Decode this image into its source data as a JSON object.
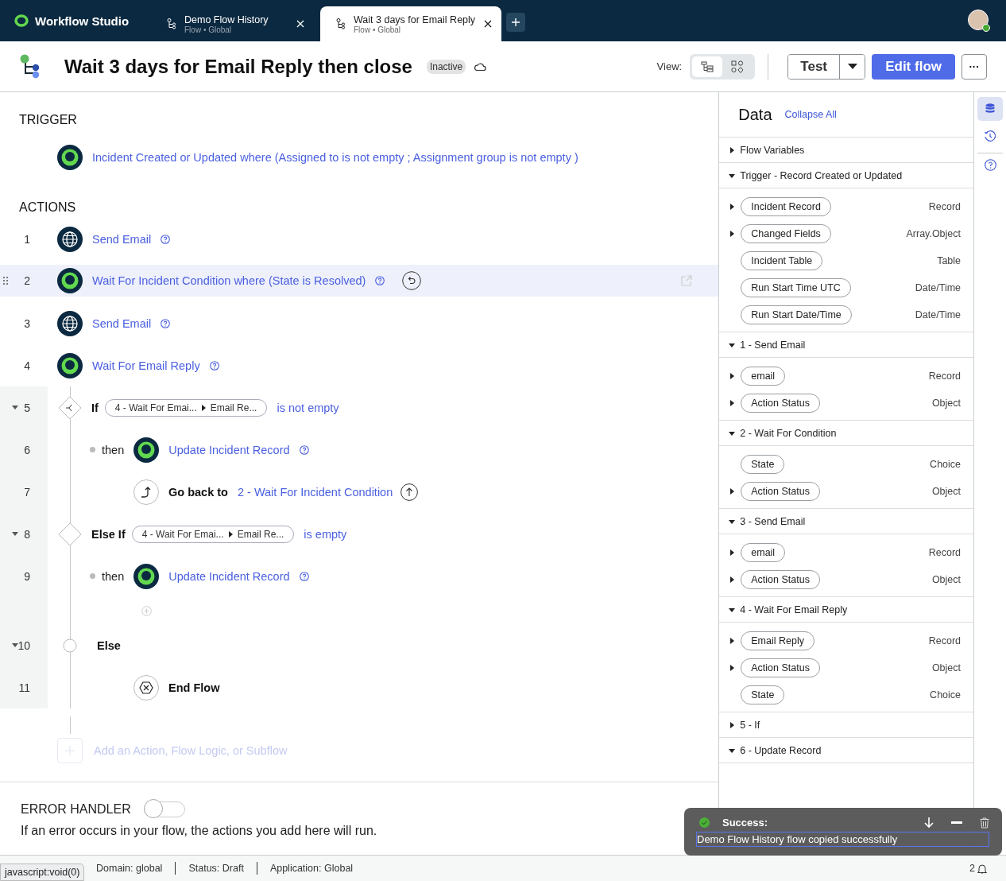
{
  "topbar": {
    "app_name": "Workflow Studio",
    "tabs": [
      {
        "title": "Demo Flow History",
        "subtitle": "Flow • Global",
        "selected": false
      },
      {
        "title": "Wait 3 days for Email Reply",
        "subtitle": "Flow • Global",
        "selected": true
      }
    ]
  },
  "header": {
    "title": "Wait 3 days for Email Reply then close",
    "badge": "Inactive",
    "view_label": "View:",
    "views": [
      {
        "kind": "tree",
        "selected": true
      },
      {
        "kind": "diagram",
        "selected": false
      }
    ],
    "test_button": "Test",
    "edit_button": "Edit flow",
    "more_button": "···"
  },
  "trigger": {
    "heading": "TRIGGER",
    "label": "Incident Created or Updated where (Assigned to is not empty ; Assignment group is not empty )"
  },
  "actions_heading": "ACTIONS",
  "actions": [
    {
      "number": "1",
      "kind": "email",
      "label": "Send Email",
      "selected": false
    },
    {
      "number": "2",
      "kind": "record",
      "label": "Wait For Incident Condition where (State is Resolved)",
      "selected": true
    },
    {
      "number": "3",
      "kind": "email",
      "label": "Send Email",
      "selected": false
    },
    {
      "number": "4",
      "kind": "record",
      "label": "Wait For Email Reply",
      "selected": false
    },
    {
      "number": "5",
      "kind": "if",
      "keyword": "If",
      "pill": [
        "4 - Wait For Emai...",
        "Email Re..."
      ],
      "condition": "is not empty",
      "expanded": true,
      "children": [
        {
          "number": "6",
          "kind": "record",
          "lead": "then",
          "label": "Update Incident Record",
          "selected": false
        },
        {
          "number": "7",
          "kind": "goback",
          "keyword": "Go back to",
          "target": "2 - Wait For Incident Condition"
        }
      ]
    },
    {
      "number": "8",
      "kind": "elseif",
      "keyword": "Else If",
      "pill": [
        "4 - Wait For Emai...",
        "Email Re..."
      ],
      "condition": "is empty",
      "expanded": true,
      "children": [
        {
          "number": "9",
          "kind": "record",
          "lead": "then",
          "label": "Update Incident Record",
          "selected": false
        }
      ]
    },
    {
      "number": "10",
      "kind": "else",
      "keyword": "Else",
      "expanded": true,
      "children": [
        {
          "number": "11",
          "kind": "end",
          "label": "End Flow"
        }
      ]
    }
  ],
  "add_action": "Add an Action, Flow Logic, or Subflow",
  "error_handler": {
    "heading": "ERROR HANDLER",
    "on": false,
    "description": "If an error occurs in your flow, the actions you add here will run."
  },
  "data_panel": {
    "title": "Data",
    "collapse_all": "Collapse All",
    "sections": [
      {
        "title": "Flow Variables",
        "expanded": false
      },
      {
        "title": "Trigger - Record Created or Updated",
        "expanded": true,
        "rows": [
          {
            "label": "Incident Record",
            "type": "Record",
            "expandable": true
          },
          {
            "label": "Changed Fields",
            "type": "Array.Object",
            "expandable": true
          },
          {
            "label": "Incident Table",
            "type": "Table",
            "expandable": false
          },
          {
            "label": "Run Start Time UTC",
            "type": "Date/Time",
            "expandable": false
          },
          {
            "label": "Run Start Date/Time",
            "type": "Date/Time",
            "expandable": false
          }
        ]
      },
      {
        "title": "1 - Send Email",
        "expanded": true,
        "rows": [
          {
            "label": "email",
            "type": "Record",
            "expandable": true
          },
          {
            "label": "Action Status",
            "type": "Object",
            "expandable": true
          }
        ]
      },
      {
        "title": "2 - Wait For Condition",
        "expanded": true,
        "rows": [
          {
            "label": "State",
            "type": "Choice",
            "expandable": false
          },
          {
            "label": "Action Status",
            "type": "Object",
            "expandable": true
          }
        ]
      },
      {
        "title": "3 - Send Email",
        "expanded": true,
        "rows": [
          {
            "label": "email",
            "type": "Record",
            "expandable": true
          },
          {
            "label": "Action Status",
            "type": "Object",
            "expandable": true
          }
        ]
      },
      {
        "title": "4 - Wait For Email Reply",
        "expanded": true,
        "rows": [
          {
            "label": "Email Reply",
            "type": "Record",
            "expandable": true
          },
          {
            "label": "Action Status",
            "type": "Object",
            "expandable": true
          },
          {
            "label": "State",
            "type": "Choice",
            "expandable": false
          }
        ]
      },
      {
        "title": "5 - If",
        "expanded": false
      },
      {
        "title": "6 - Update Record",
        "expanded": true
      }
    ]
  },
  "rail": [
    {
      "kind": "data",
      "selected": true
    },
    {
      "kind": "history",
      "selected": false
    },
    {
      "kind": "help",
      "selected": false
    }
  ],
  "status_bar": {
    "items": [
      "Domain: global",
      "Status: Draft",
      "Application: Global"
    ],
    "notifications": "2",
    "link_preview": "javascript:void(0)"
  },
  "toast": {
    "title": "Success:",
    "message": "Demo Flow History flow copied successfully"
  }
}
